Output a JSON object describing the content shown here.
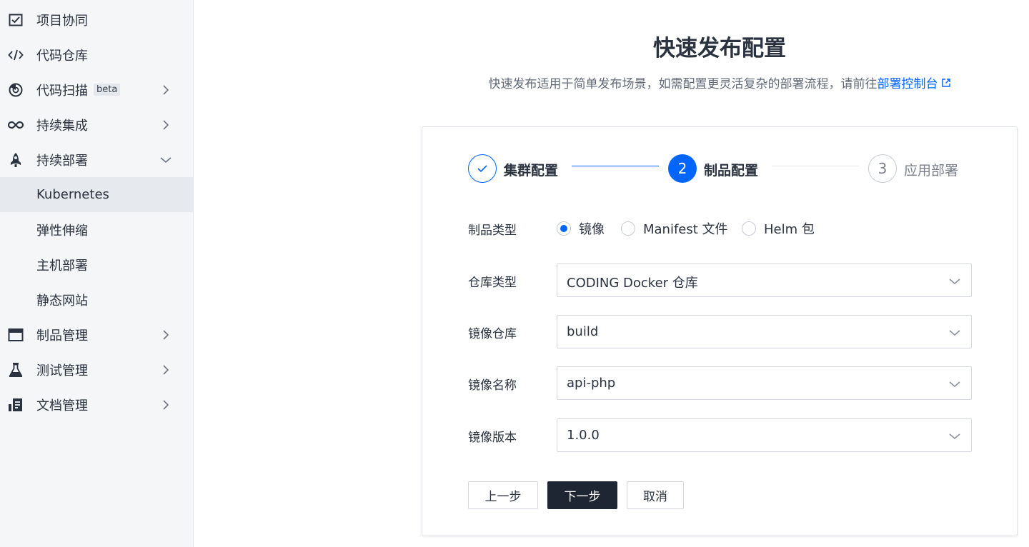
{
  "sidebar": {
    "items": [
      {
        "label": "项目协同",
        "icon": "checkbox-icon",
        "chevron": ""
      },
      {
        "label": "代码仓库",
        "icon": "code-icon",
        "chevron": ""
      },
      {
        "label": "代码扫描",
        "icon": "scan-icon",
        "badge": "beta",
        "chevron": "right"
      },
      {
        "label": "持续集成",
        "icon": "infinity-icon",
        "chevron": "right"
      },
      {
        "label": "持续部署",
        "icon": "rocket-icon",
        "chevron": "down"
      },
      {
        "label": "Kubernetes",
        "icon": "",
        "chevron": "",
        "active": true
      },
      {
        "label": "弹性伸缩",
        "icon": "",
        "chevron": ""
      },
      {
        "label": "主机部署",
        "icon": "",
        "chevron": ""
      },
      {
        "label": "静态网站",
        "icon": "",
        "chevron": ""
      },
      {
        "label": "制品管理",
        "icon": "artifact-icon",
        "chevron": "right"
      },
      {
        "label": "测试管理",
        "icon": "flask-icon",
        "chevron": "right"
      },
      {
        "label": "文档管理",
        "icon": "document-icon",
        "chevron": "right"
      }
    ]
  },
  "main": {
    "title": "快速发布配置",
    "description": "快速发布适用于简单发布场景，如需配置更灵活复杂的部署流程，请前往",
    "link_text": "部署控制台"
  },
  "steps": [
    {
      "number": "",
      "label": "集群配置",
      "state": "done"
    },
    {
      "number": "2",
      "label": "制品配置",
      "state": "current"
    },
    {
      "number": "3",
      "label": "应用部署",
      "state": "pending"
    }
  ],
  "form": {
    "artifact_type": {
      "label": "制品类型",
      "options": [
        "镜像",
        "Manifest 文件",
        "Helm 包"
      ],
      "selected": "镜像"
    },
    "repo_type": {
      "label": "仓库类型",
      "value": "CODING Docker 仓库"
    },
    "image_repo": {
      "label": "镜像仓库",
      "value": "build"
    },
    "image_name": {
      "label": "镜像名称",
      "value": "api-php"
    },
    "image_version": {
      "label": "镜像版本",
      "value": "1.0.0"
    }
  },
  "buttons": {
    "prev": "上一步",
    "next": "下一步",
    "cancel": "取消"
  },
  "colors": {
    "accent": "#0066ff",
    "primary_button": "#1e2633",
    "sidebar_bg": "#f5f6f8",
    "sidebar_active": "#e6e9ee"
  }
}
